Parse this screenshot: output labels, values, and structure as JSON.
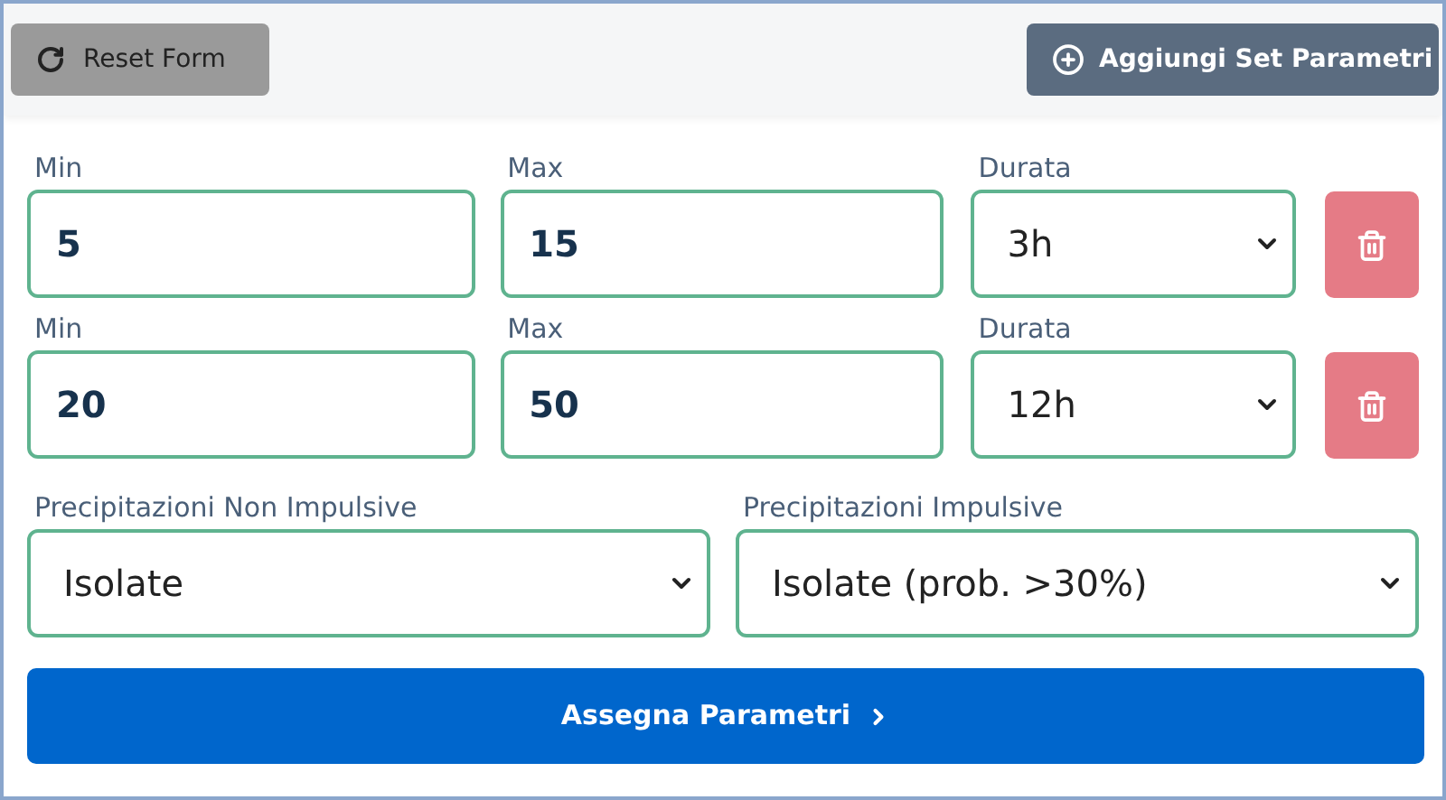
{
  "header": {
    "reset_button": "Reset Form",
    "add_button": "Aggiungi Set Parametri"
  },
  "parameter_sets": [
    {
      "min_label": "Min",
      "min_value": "5",
      "max_label": "Max",
      "max_value": "15",
      "duration_label": "Durata",
      "duration_value": "3h"
    },
    {
      "min_label": "Min",
      "min_value": "20",
      "max_label": "Max",
      "max_value": "50",
      "duration_label": "Durata",
      "duration_value": "12h"
    }
  ],
  "precipitation": [
    {
      "label": "Precipitazioni Non Impulsive",
      "value": "Isolate"
    },
    {
      "label": "Precipitazioni Impulsive",
      "value": "Isolate (prob. >30%)"
    }
  ],
  "submit_button": "Assegna Parametri"
}
